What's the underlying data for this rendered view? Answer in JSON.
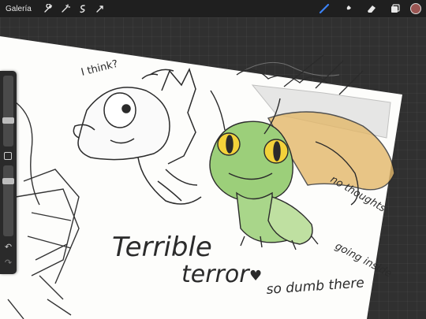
{
  "app": {
    "toolbar": {
      "gallery_label": "Galería",
      "left_tools": [
        "wrench-icon",
        "magic-wand-icon",
        "selection-icon",
        "transform-icon"
      ],
      "right_tools": [
        "brush-icon",
        "smudge-icon",
        "eraser-icon",
        "layers-icon"
      ],
      "active_tool": "brush-icon",
      "current_color": "#9a5552",
      "active_tool_color": "#3b82f6"
    },
    "sidebar": {
      "brush_size_level": 0.35,
      "opacity_level": 0.2,
      "undo_icon": "undo-icon",
      "redo_icon": "redo-icon"
    }
  },
  "canvas": {
    "annotations": {
      "i_think": "I think?",
      "terrible": "Terrible",
      "terror": "terror",
      "heart": "♥",
      "so_dumb_there": "so dumb there",
      "no_thoughts": "no thoughts",
      "going_inside": "going inside"
    },
    "colors": {
      "paper": "#fdfdfb",
      "ink": "#2b2b2b",
      "dragon_green": "#9ccf7a",
      "dragon_belly": "#d9e6b8",
      "dragon_orange": "#e3b86a",
      "eye_yellow": "#f3d23a"
    }
  }
}
